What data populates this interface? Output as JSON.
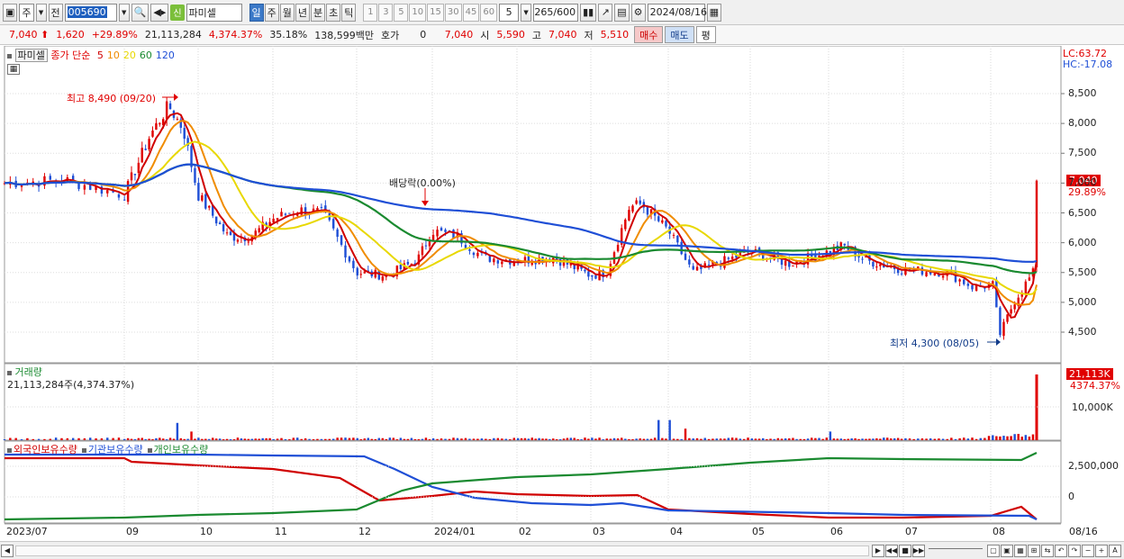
{
  "toolbar": {
    "period_type": "주",
    "prev_label": "전",
    "stock_code": "005690",
    "badge": "신",
    "stock_name": "파미셀",
    "periods": [
      {
        "label": "일",
        "active": true
      },
      {
        "label": "주",
        "active": false
      },
      {
        "label": "월",
        "active": false
      },
      {
        "label": "년",
        "active": false
      },
      {
        "label": "분",
        "active": false
      },
      {
        "label": "초",
        "active": false
      },
      {
        "label": "틱",
        "active": false
      }
    ],
    "intervals": [
      "1",
      "3",
      "5",
      "10",
      "15",
      "30",
      "45",
      "60"
    ],
    "interval_value": "5",
    "count_current": "265",
    "count_total": "/600",
    "date": "2024/08/16",
    "icons": [
      "candle-type-icon",
      "line-tool-icon",
      "save-icon",
      "settings-icon"
    ]
  },
  "quote": {
    "price": "7,040",
    "change": "1,620",
    "change_pct": "+29.89%",
    "volume": "21,113,284",
    "volume_pct": "4,374.37%",
    "turnover_pct": "35.18%",
    "amount": "138,599백만",
    "hoga_label": "호가",
    "hoga_value": "0",
    "hoga_price": "7,040",
    "open_label": "시",
    "open": "5,590",
    "high_label": "고",
    "high": "7,040",
    "low_label": "저",
    "low": "5,510",
    "buy_label": "매수",
    "sell_label": "매도",
    "avg_label": "평"
  },
  "price_pane": {
    "title": "파미셀",
    "ma_label": "종가 단순",
    "ma_periods": [
      {
        "period": "5",
        "color": "#d00000"
      },
      {
        "period": "10",
        "color": "#f08c00"
      },
      {
        "period": "20",
        "color": "#e8d800"
      },
      {
        "period": "60",
        "color": "#1a8a30"
      },
      {
        "period": "120",
        "color": "#1f4fd6"
      }
    ],
    "lc": "LC:63.72",
    "hc": "HC:-17.08",
    "last_price": "7,040",
    "last_pct": "29.89%",
    "high_annot": "최고 8,490 (09/20)",
    "low_annot": "최저 4,300 (08/05)",
    "event_annot": "배당락(0.00%)",
    "y_ticks": [
      "8,500",
      "8,000",
      "7,500",
      "7,000",
      "6,500",
      "6,000",
      "5,500",
      "5,000",
      "4,500"
    ]
  },
  "volume_pane": {
    "title": "거래량",
    "value": "21,113,284주(4,374.37%)",
    "last": "21,113K",
    "last_pct": "4374.37%",
    "tick": "10,000K"
  },
  "holdings_pane": {
    "legend": [
      {
        "label": "외국인보유수량",
        "color": "#d00000"
      },
      {
        "label": "기관보유수량",
        "color": "#1f4fd6"
      },
      {
        "label": "개인보유수량",
        "color": "#1a8a30"
      }
    ],
    "ticks": [
      "2,500,000",
      "0"
    ]
  },
  "x_axis": [
    "2023/07",
    "09",
    "10",
    "11",
    "12",
    "2024/01",
    "02",
    "03",
    "04",
    "05",
    "06",
    "07",
    "08",
    "08/16"
  ],
  "chart_data": {
    "type": "candlestick",
    "x_range": [
      "2023/07",
      "2024/08/16"
    ],
    "y_range": [
      4300,
      8490
    ],
    "price_path": [
      [
        "2023/07",
        7000
      ],
      [
        "2023/08",
        6600
      ],
      [
        "2023/09",
        7050
      ],
      [
        "2023/09/20",
        8490
      ],
      [
        "2023/10",
        6400
      ],
      [
        "2023/11",
        6100
      ],
      [
        "2023/11/20",
        6500
      ],
      [
        "2023/12",
        5400
      ],
      [
        "2024/01",
        6200
      ],
      [
        "2024/02",
        5600
      ],
      [
        "2024/03",
        5400
      ],
      [
        "2024/03/20",
        6700
      ],
      [
        "2024/04",
        5500
      ],
      [
        "2024/05",
        5800
      ],
      [
        "2024/06",
        5900
      ],
      [
        "2024/07",
        5400
      ],
      [
        "2024/08/05",
        4300
      ],
      [
        "2024/08/16",
        7040
      ]
    ],
    "annotations": [
      "최고 8,490 (09/20)",
      "최저 4,300 (08/05)",
      "배당락(0.00%)"
    ],
    "last_close": 7040,
    "last_volume": 21113284
  }
}
